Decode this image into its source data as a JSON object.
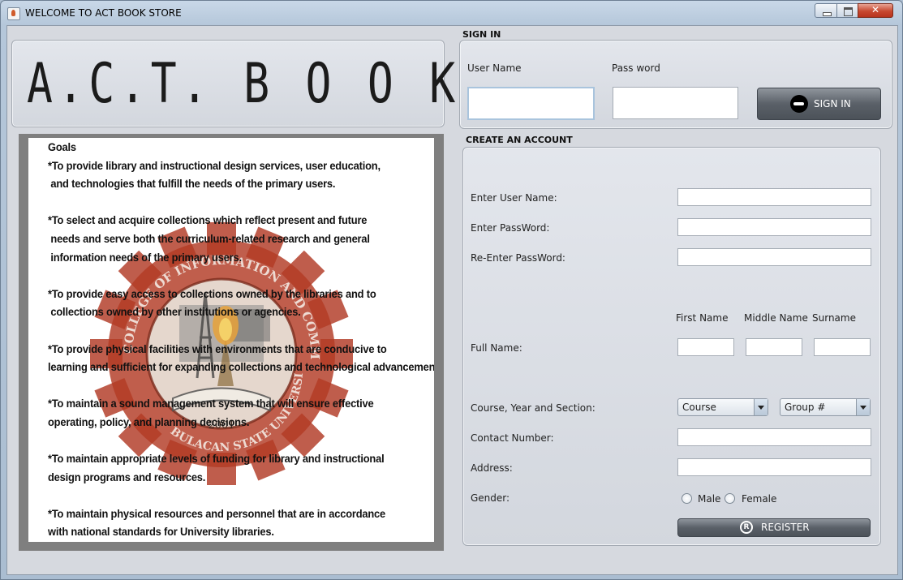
{
  "window": {
    "title": "WELCOME TO ACT BOOK STORE"
  },
  "logo": {
    "text": "A.C.T. B O O K·S T O R E"
  },
  "goals": {
    "lines": [
      "Goals",
      "*To provide library and instructional design services, user education,",
      " and technologies that fulfill the needs of the primary users.",
      "",
      "*To select and acquire collections which reflect present and future",
      " needs and serve both the curriculum-related research and general",
      " information needs of the primary users.",
      "",
      "*To provide easy access to collections owned by the libraries and to",
      " collections owned by other institutions or agencies.",
      "",
      "*To provide physical facilities with environments that are conducive to",
      "learning and sufficient for expanding collections and technological advancement.",
      "",
      "*To maintain a sound management system that will ensure effective",
      "operating, policy, and planning decisions.",
      "",
      "*To maintain appropriate levels of funding for library and instructional",
      "design programs and resources.",
      "",
      "*To maintain physical resources and personnel that are in accordance",
      "with national standards for University libraries."
    ],
    "seal_text_top": "COLLEGE OF INFORMATION AND COMMUNICATIONS TECHNOLOGY",
    "seal_text_bottom": "BULACAN STATE UNIVERSITY",
    "seal_year": "2001"
  },
  "signin": {
    "section_label": "SIGN IN",
    "username_label": "User Name",
    "password_label": "Pass word",
    "username_value": "",
    "password_value": "",
    "button_label": "SIGN IN"
  },
  "register": {
    "section_label": "CREATE AN ACCOUNT",
    "username_label": "Enter User Name:",
    "password_label": "Enter PassWord:",
    "reenter_label": "Re-Enter PassWord:",
    "fullname_label": "Full Name:",
    "first_name_label": "First Name",
    "middle_name_label": "Middle Name",
    "surname_label": "Surname",
    "course_label": "Course, Year and Section:",
    "course_value": "Course",
    "group_value": "Group #",
    "contact_label": "Contact Number:",
    "address_label": "Address:",
    "gender_label": "Gender:",
    "male_label": "Male",
    "female_label": "Female",
    "button_label": "REGISTER"
  },
  "colors": {
    "seal_gear": "#b23a25",
    "button_dark": "#5a6068"
  }
}
